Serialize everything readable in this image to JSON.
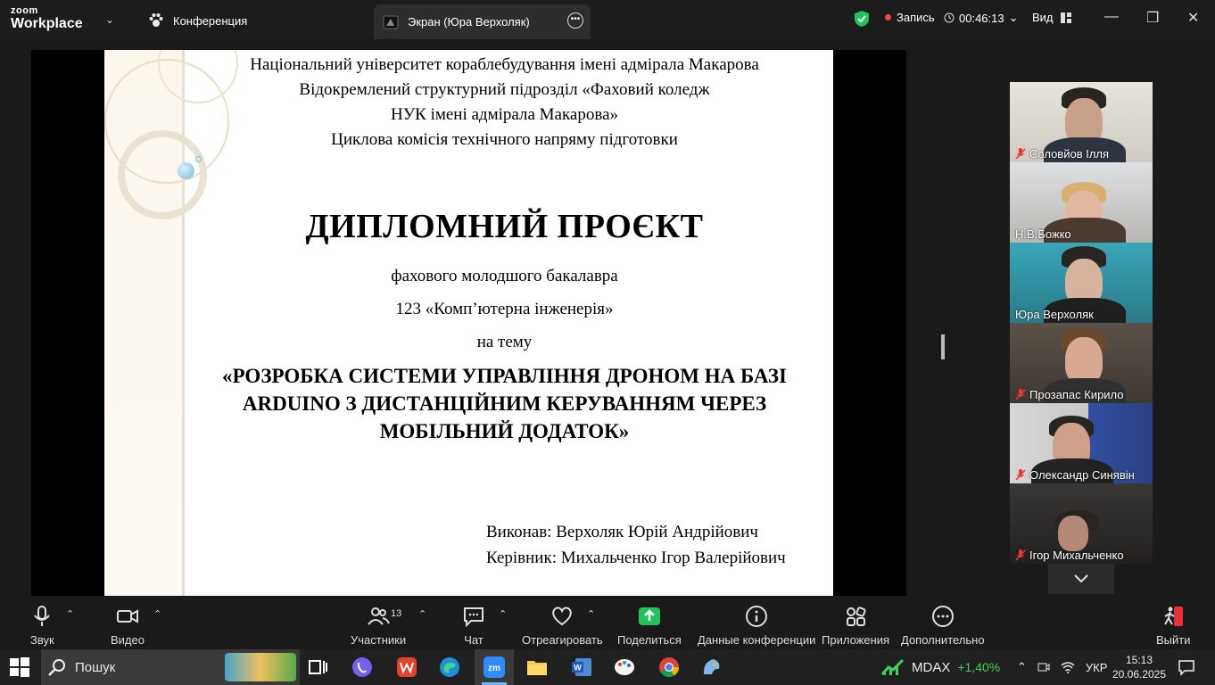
{
  "app": {
    "logo_top": "zoom",
    "logo_bottom": "Workplace",
    "tab_conference": "Конференция",
    "tab_screen": "Экран (Юра Верхоляк)",
    "record_label": "Запись",
    "timer": "00:46:13",
    "view_label": "Вид"
  },
  "slide": {
    "line1": "Національний університет кораблебудування імені адмірала Макарова",
    "line2": "Відокремлений структурний підрозділ «Фаховий коледж",
    "line3": "НУК імені адмірала Макарова»",
    "line4": "Циклова комісія  технічного напряму підготовки",
    "title": "ДИПЛОМНИЙ ПРОЄКТ",
    "degree": "фахового  молодшого бакалавра",
    "specialty": "123 «Комп’ютерна інженерія»",
    "on_topic": "на тему",
    "topic1": "«РОЗРОБКА СИСТЕМИ УПРАВЛІННЯ ДРОНОМ НА БАЗІ",
    "topic2": "ARDUINO З ДИСТАНЦІЙНИМ КЕРУВАННЯМ ЧЕРЕЗ",
    "topic3": "МОБІЛЬНИЙ ДОДАТОК»",
    "author": "Виконав: Верхоляк Юрій  Андрійович",
    "supervisor": "Керівник: Михальченко Ігор Валерійович"
  },
  "participants": [
    {
      "name": "Соловйов Ілля",
      "muted": true
    },
    {
      "name": "Н.В.Божко",
      "muted": false
    },
    {
      "name": "Юра Верхоляк",
      "muted": false
    },
    {
      "name": "Прозапас Кирило",
      "muted": true
    },
    {
      "name": "Олександр Синявін",
      "muted": true
    },
    {
      "name": "Ігор Михальченко",
      "muted": true
    }
  ],
  "toolbar": {
    "audio": "Звук",
    "video": "Видео",
    "participants": "Участники",
    "participants_count": "13",
    "chat": "Чат",
    "react": "Отреагировать",
    "share": "Поделиться",
    "info": "Данные конференции",
    "apps": "Приложения",
    "more": "Дополнительно",
    "leave": "Выйти"
  },
  "taskbar": {
    "search": "Пошук",
    "stock_name": "MDAX",
    "stock_change": "+1,40%",
    "lang": "УКР",
    "time": "15:13",
    "date": "20.06.2025"
  },
  "colors": {
    "active_border": "#2edc5a",
    "share_green": "#1fc45b",
    "record_red": "#ff4444",
    "stock_green": "#3fd15a"
  }
}
